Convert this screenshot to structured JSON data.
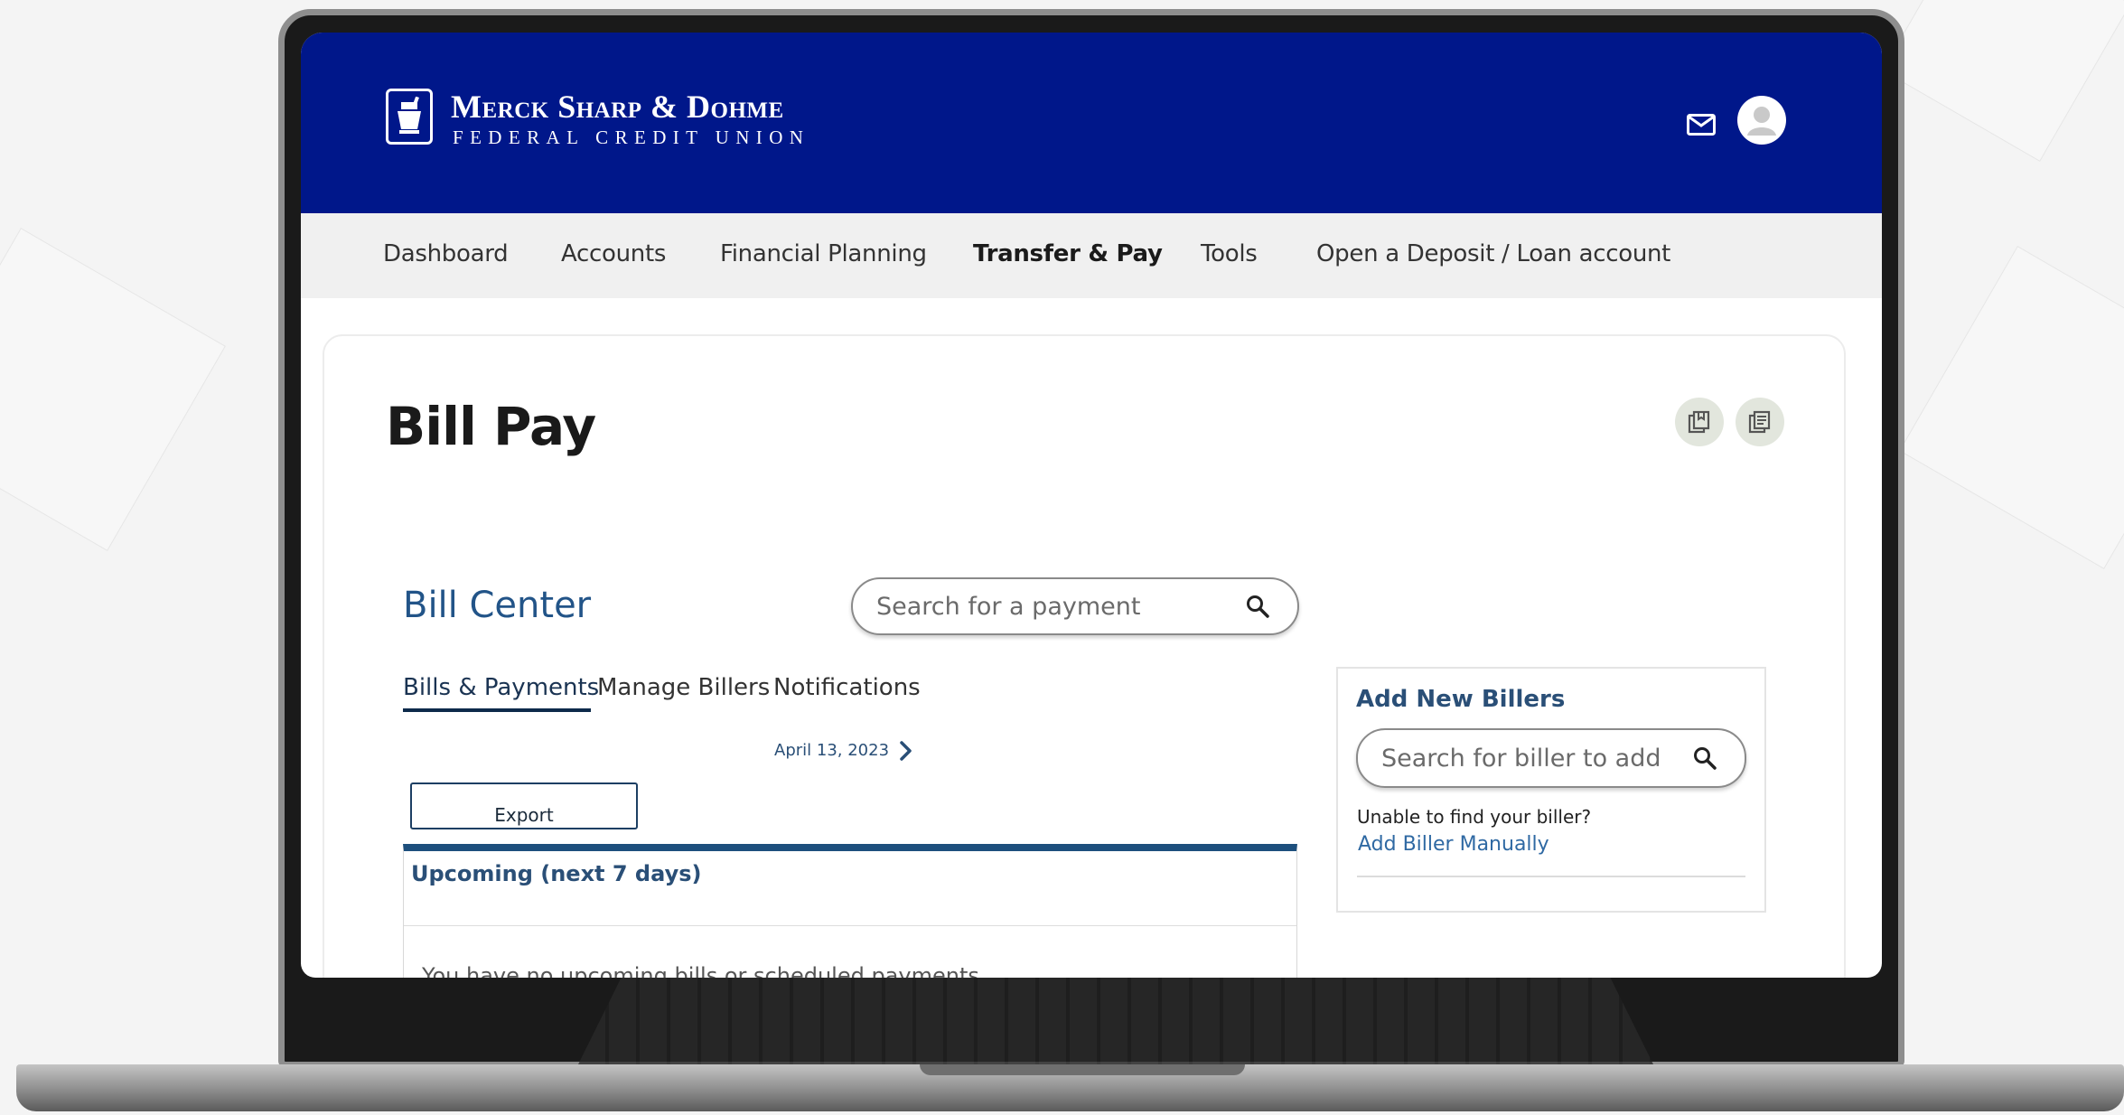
{
  "brand": {
    "name_line1": "Merck Sharp & Dohme",
    "name_line2": "FEDERAL CREDIT UNION",
    "header_color": "#00178a"
  },
  "header": {
    "icons": [
      "mail-icon",
      "user-icon"
    ]
  },
  "nav": {
    "items": [
      {
        "label": "Dashboard",
        "active": false
      },
      {
        "label": "Accounts",
        "active": false
      },
      {
        "label": "Financial Planning",
        "active": false
      },
      {
        "label": "Transfer & Pay",
        "active": true
      },
      {
        "label": "Tools",
        "active": false
      },
      {
        "label": "Open a Deposit / Loan account",
        "active": false
      }
    ]
  },
  "page": {
    "title": "Bill Pay",
    "action_icons": [
      "bookmark-icon",
      "print-icon"
    ]
  },
  "bill_center": {
    "title": "Bill Center",
    "search_placeholder": "Search for a payment",
    "tabs": [
      {
        "label": "Bills & Payments",
        "active": true
      },
      {
        "label": "Manage Billers",
        "active": false
      },
      {
        "label": "Notifications",
        "active": false
      }
    ],
    "date": "April 13, 2023",
    "export_label": "Export",
    "upcoming_title": "Upcoming (next 7 days)",
    "empty_message": "You have no upcoming bills or scheduled payments"
  },
  "add_billers": {
    "title": "Add New Billers",
    "search_placeholder": "Search for biller to add",
    "help_text": "Unable to find your biller?",
    "link_label": "Add Biller Manually"
  }
}
